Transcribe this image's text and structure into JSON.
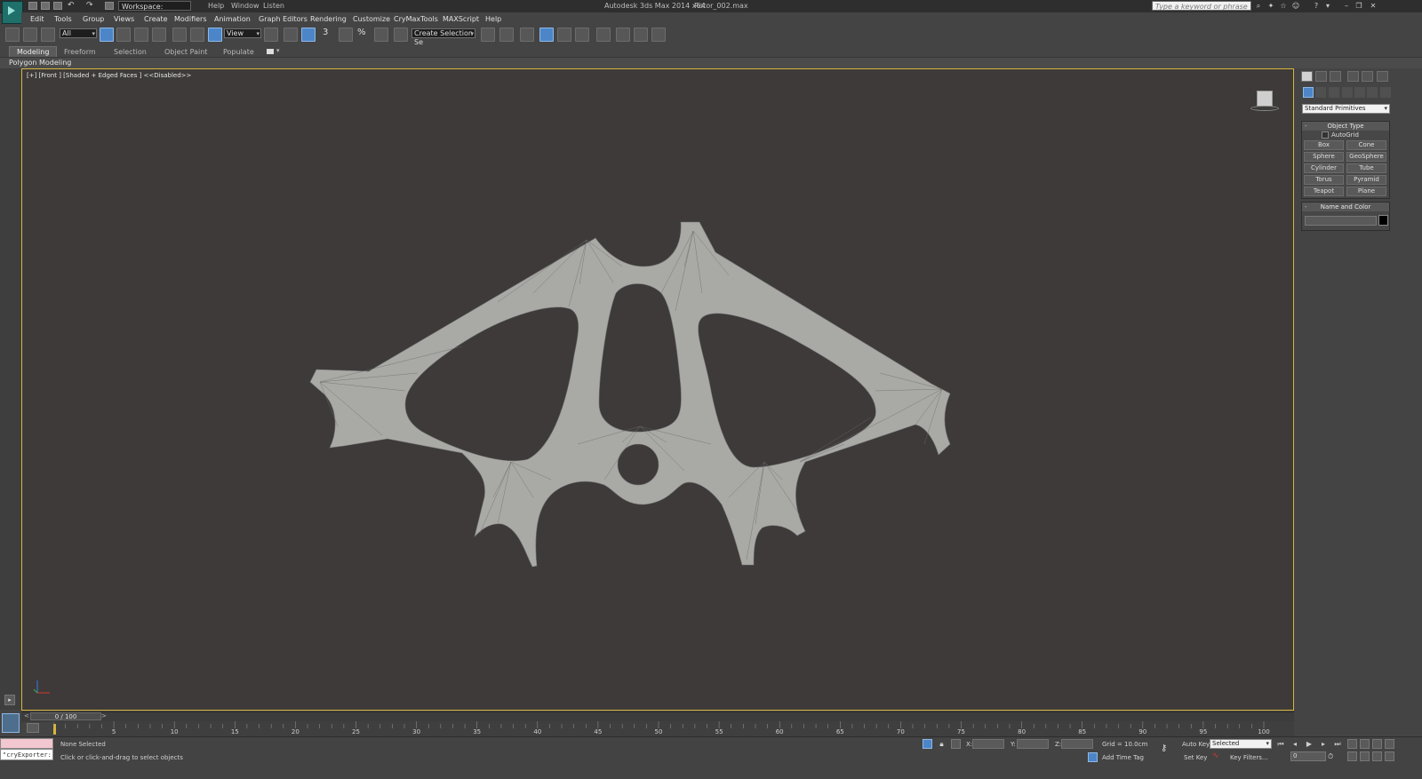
{
  "title_bar": {
    "workspace_label": "Workspace: Default",
    "faded_menus": [
      "Help",
      "Window",
      "Listen"
    ],
    "app_title": "Autodesk 3ds Max  2014 x64",
    "file_name": "Rotor_002.max",
    "search_placeholder": "Type a keyword or phrase"
  },
  "menu": [
    "Edit",
    "Tools",
    "Group",
    "Views",
    "Create",
    "Modifiers",
    "Animation",
    "Graph Editors",
    "Rendering",
    "Customize",
    "CryMaxTools",
    "MAXScript",
    "Help"
  ],
  "toolbar": {
    "selection_filter": "All",
    "reference_coord": "View",
    "snap_3": "3",
    "named_selection": "Create Selection Se"
  },
  "ribbon": {
    "tabs": [
      "Modeling",
      "Freeform",
      "Selection",
      "Object Paint",
      "Populate"
    ],
    "panel_label": "Polygon Modeling"
  },
  "viewport": {
    "label": "[+] [Front ] [Shaded + Edged Faces ]  <<Disabled>>",
    "mesh_fill": "#a9a9a6",
    "background": "#3d3a39",
    "border": "#d7b63b"
  },
  "command_panel": {
    "category_dropdown": "Standard Primitives",
    "object_type": {
      "header": "Object Type",
      "autogrid_label": "AutoGrid",
      "buttons": [
        "Box",
        "Cone",
        "Sphere",
        "GeoSphere",
        "Cylinder",
        "Tube",
        "Torus",
        "Pyramid",
        "Teapot",
        "Plane"
      ]
    },
    "name_and_color": {
      "header": "Name and Color"
    }
  },
  "timeline": {
    "frame_display": "0 / 100",
    "ticks": [
      "5",
      "10",
      "15",
      "20",
      "25",
      "30",
      "35",
      "40",
      "45",
      "50",
      "55",
      "60",
      "65",
      "70",
      "75",
      "80",
      "85",
      "90",
      "95",
      "100"
    ]
  },
  "status": {
    "maxscript_text": "\"cryExporter:",
    "selection_status": "None Selected",
    "prompt": "Click or click-and-drag to select objects",
    "x_label": "X:",
    "y_label": "Y:",
    "z_label": "Z:",
    "grid": "Grid = 10.0cm",
    "add_time_tag": "Add Time Tag",
    "auto_key": "Auto Key",
    "auto_key_mode": "Selected",
    "set_key": "Set Key",
    "key_filters": "Key Filters...",
    "current_frame": "0"
  }
}
